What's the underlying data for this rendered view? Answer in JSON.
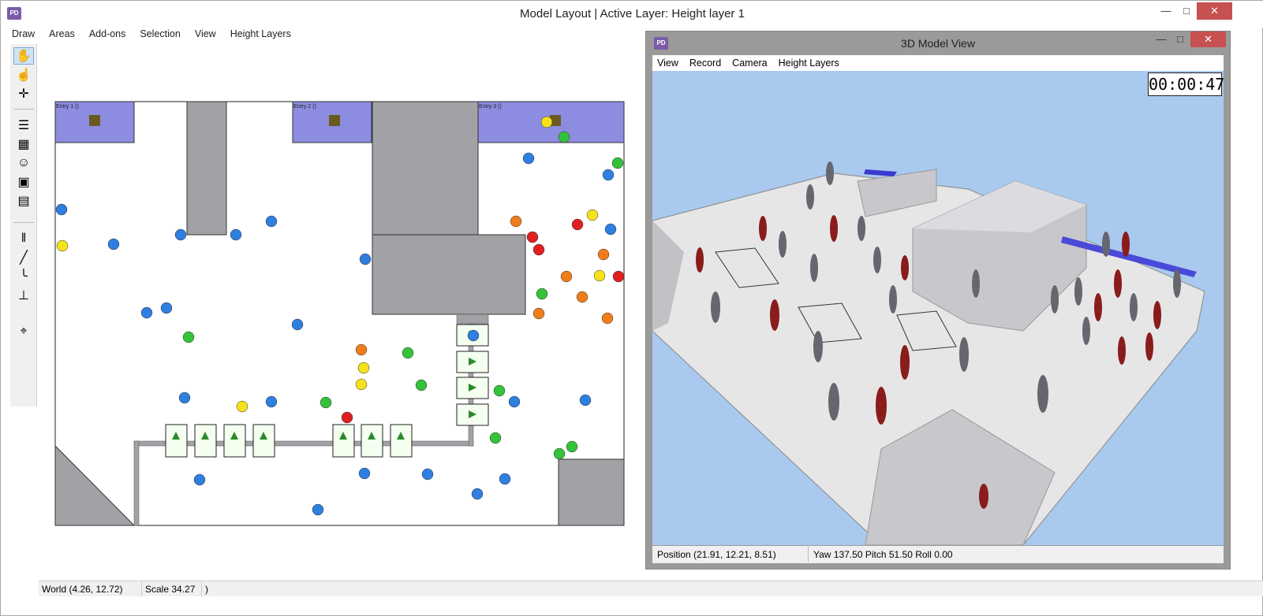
{
  "window": {
    "title": "Model Layout | Active Layer: Height layer 1",
    "app_icon": "PD",
    "controls": {
      "minimize": "—",
      "maximize": "□",
      "close": "✕"
    }
  },
  "menu": [
    "Draw",
    "Areas",
    "Add-ons",
    "Selection",
    "View",
    "Height Layers"
  ],
  "toolbar": {
    "tools": [
      {
        "icon": "hand-pan-icon",
        "glyph": "✋",
        "active": true
      },
      {
        "icon": "pointer-hand-icon",
        "glyph": "☝",
        "active": false
      },
      {
        "icon": "move-arrows-icon",
        "glyph": "✛",
        "active": false
      },
      {
        "icon": "stairs-layer-icon",
        "glyph": "☰",
        "active": false
      },
      {
        "icon": "area-blocks-icon",
        "glyph": "▦",
        "active": false
      },
      {
        "icon": "agent-icon",
        "glyph": "☺",
        "active": false
      },
      {
        "icon": "door-icon",
        "glyph": "▣",
        "active": false
      },
      {
        "icon": "map-icon",
        "glyph": "▤",
        "active": false
      },
      {
        "icon": "gate-icon",
        "glyph": "‖",
        "active": false
      },
      {
        "icon": "stair-line-icon",
        "glyph": "╱",
        "active": false
      },
      {
        "icon": "escalator-icon",
        "glyph": "╰",
        "active": false
      },
      {
        "icon": "elevator-icon",
        "glyph": "⊥",
        "active": false
      },
      {
        "icon": "measure-tape-icon",
        "glyph": "⌖",
        "active": false
      }
    ]
  },
  "status": {
    "world": "World (4.26, 12.72)",
    "scale": "Scale 34.27",
    "extra": ")"
  },
  "layout_2d": {
    "colors": {
      "spawn_area": "#8c8ce0",
      "wall": "#a2a2a6",
      "agent_blue": "#2e7fe0",
      "agent_green": "#34c23a",
      "agent_yellow": "#f5e21a",
      "agent_orange": "#f07d1c",
      "agent_red": "#e02020"
    },
    "spawn_labels": [
      "Entry 1 ()",
      "Entry 2 ()",
      "Entry 3 ()"
    ]
  },
  "view3d": {
    "title": "3D Model View",
    "menu": [
      "View",
      "Record",
      "Camera",
      "Height Layers"
    ],
    "timer": "00:00:47",
    "position": "Position (21.91, 12.21, 8.51)",
    "orientation": "Yaw 137.50 Pitch 51.50 Roll 0.00",
    "colors": {
      "sky": "#a9c9ee",
      "floor": "#e6e6e6",
      "block": "#c8c8cc"
    }
  }
}
